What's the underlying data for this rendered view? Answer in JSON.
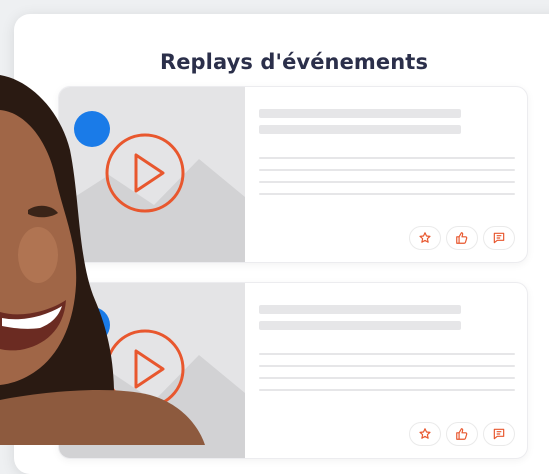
{
  "panel": {
    "title": "Replays d'événements"
  },
  "cards": [
    {
      "kind": "video-replay",
      "actions": [
        "favorite-icon",
        "like-icon",
        "comment-icon"
      ]
    },
    {
      "kind": "video-replay",
      "actions": [
        "favorite-icon",
        "like-icon",
        "comment-icon"
      ]
    }
  ],
  "colors": {
    "accent": "#e8572e",
    "badge": "#1a7be8",
    "title": "#2b2f4a",
    "placeholder": "#e6e6e8"
  }
}
